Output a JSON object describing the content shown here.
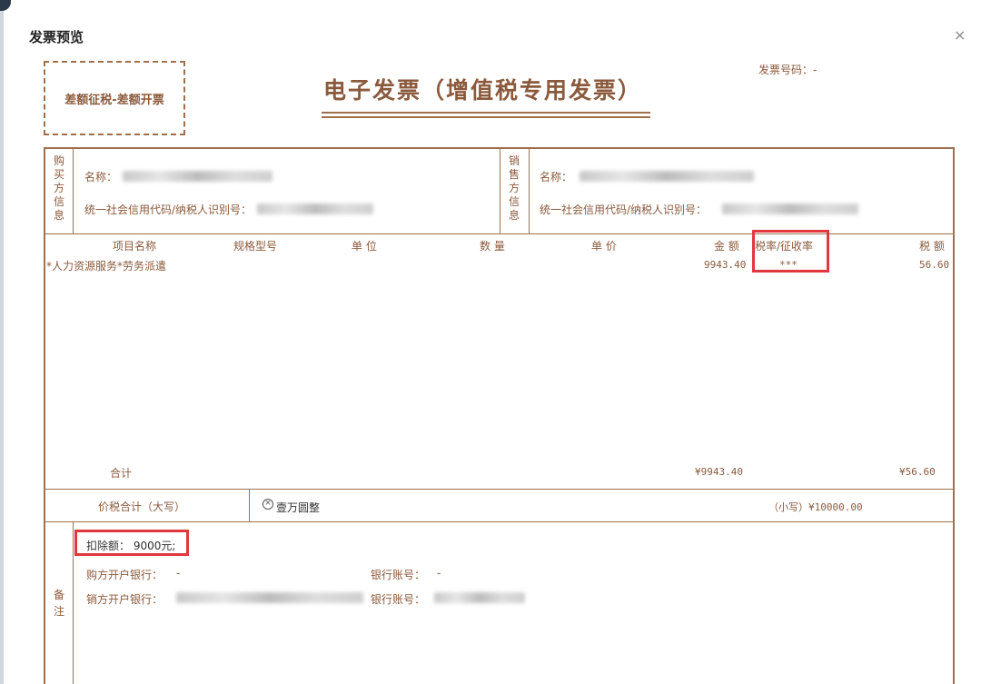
{
  "dialog": {
    "title": "发票预览",
    "close_label": "×"
  },
  "stamp": {
    "label": "差额征税-差额开票"
  },
  "invoice": {
    "title": "电子发票（增值税专用发票）",
    "number_label": "发票号码：-"
  },
  "buyer": {
    "side_label": [
      "购",
      "买",
      "方",
      "信",
      "息"
    ],
    "name_label": "名称：",
    "tax_id_label": "统一社会信用代码/纳税人识别号："
  },
  "seller": {
    "side_label": [
      "销",
      "售",
      "方",
      "信",
      "息"
    ],
    "name_label": "名称：",
    "tax_id_label": "统一社会信用代码/纳税人识别号："
  },
  "items_table": {
    "headers": {
      "item_name": "项目名称",
      "spec": "规格型号",
      "unit": "单 位",
      "quantity": "数 量",
      "unit_price": "单 价",
      "amount": "金 额",
      "tax_rate": "税率/征收率",
      "tax": "税 额"
    },
    "rows": [
      {
        "item_name": "*人力资源服务*劳务派遣",
        "amount": "9943.40",
        "tax_rate": "***",
        "tax": "56.60"
      }
    ],
    "total_label": "合计",
    "total_amount": "¥9943.40",
    "total_tax": "¥56.60"
  },
  "grand_total": {
    "label": "价税合计（大写）",
    "icon": "circle-x-icon",
    "in_words": "壹万圆整",
    "in_figures": "（小写）¥10000.00"
  },
  "remarks": {
    "side_label": [
      "备",
      "注"
    ],
    "deduction": "扣除额： 9000元;",
    "buyer_bank_label": "购方开户银行：",
    "buyer_bank_value": "-",
    "buyer_account_label": "银行账号：",
    "buyer_account_value": "-",
    "seller_bank_label": "销方开户银行：",
    "seller_account_label": "银行账号："
  },
  "colors": {
    "border": "#a0704c",
    "text": "#8b5a3c",
    "highlight": "#e0383e"
  }
}
